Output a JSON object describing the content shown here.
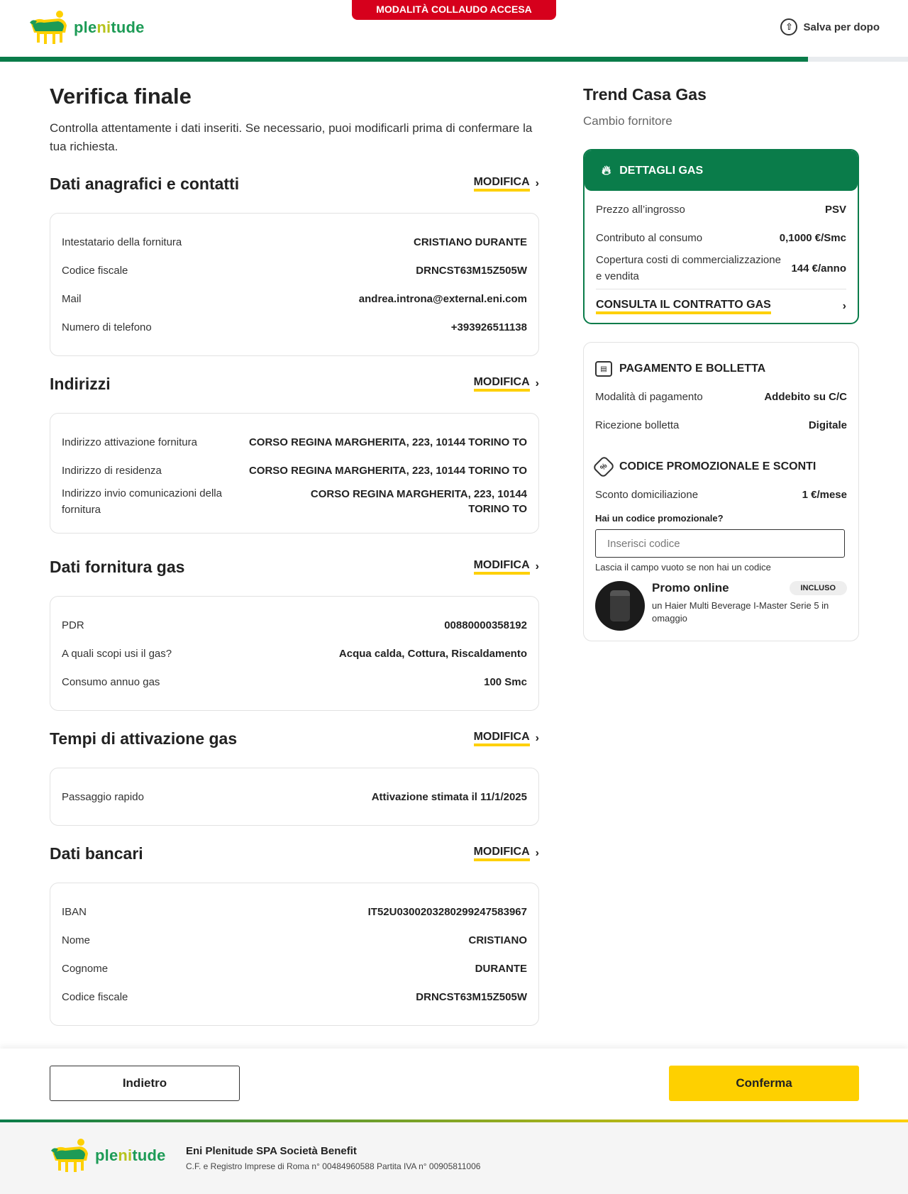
{
  "header": {
    "logo_text_a": "ple",
    "logo_text_b": "ni",
    "logo_text_c": "tude",
    "banner": "MODALITÀ COLLAUDO ACCESA",
    "save_label": "Salva per dopo",
    "progress_percent": 89
  },
  "main": {
    "title": "Verifica finale",
    "description": "Controlla attentamente i dati inseriti. Se necessario, puoi modificarli prima di confermare la tua richiesta.",
    "modifica_label": "MODIFICA",
    "sections": {
      "anagrafica": {
        "title": "Dati anagrafici e contatti",
        "rows": [
          {
            "k": "Intestatario della fornitura",
            "v": "CRISTIANO DURANTE"
          },
          {
            "k": "Codice fiscale",
            "v": "DRNCST63M15Z505W"
          },
          {
            "k": "Mail",
            "v": "andrea.introna@external.eni.com"
          },
          {
            "k": "Numero di telefono",
            "v": "+393926511138"
          }
        ]
      },
      "indirizzi": {
        "title": "Indirizzi",
        "rows": [
          {
            "k": "Indirizzo attivazione fornitura",
            "v": "CORSO REGINA MARGHERITA, 223, 10144 TORINO TO"
          },
          {
            "k": "Indirizzo di residenza",
            "v": "CORSO REGINA MARGHERITA, 223, 10144 TORINO TO"
          },
          {
            "k": "Indirizzo invio comunicazioni della fornitura",
            "v": "CORSO REGINA MARGHERITA, 223, 10144 TORINO TO"
          }
        ]
      },
      "fornitura": {
        "title": "Dati fornitura gas",
        "rows": [
          {
            "k": "PDR",
            "v": "00880000358192"
          },
          {
            "k": "A quali scopi usi il gas?",
            "v": "Acqua calda, Cottura, Riscaldamento"
          },
          {
            "k": "Consumo annuo gas",
            "v": "100 Smc"
          }
        ]
      },
      "tempi": {
        "title": "Tempi di attivazione gas",
        "rows": [
          {
            "k": "Passaggio rapido",
            "v": "Attivazione stimata il 11/1/2025"
          }
        ]
      },
      "bancari": {
        "title": "Dati bancari",
        "rows": [
          {
            "k": "IBAN",
            "v": "IT52U0300203280299247583967"
          },
          {
            "k": "Nome",
            "v": "CRISTIANO"
          },
          {
            "k": "Cognome",
            "v": "DURANTE"
          },
          {
            "k": "Codice fiscale",
            "v": "DRNCST63M15Z505W"
          }
        ]
      }
    }
  },
  "sidebar": {
    "product_title": "Trend Casa Gas",
    "product_subtitle": "Cambio fornitore",
    "gas": {
      "title": "DETTAGLI GAS",
      "rows": [
        {
          "k": "Prezzo all’ingrosso",
          "v": "PSV"
        },
        {
          "k": "Contributo al consumo",
          "v": "0,1000 €/Smc"
        },
        {
          "k": "Copertura costi di commercializzazione e vendita",
          "v": "144 €/anno"
        }
      ],
      "link": "CONSULTA IL CONTRATTO GAS"
    },
    "payment": {
      "title": "PAGAMENTO E BOLLETTA",
      "rows": [
        {
          "k": "Modalità di pagamento",
          "v": "Addebito su C/C"
        },
        {
          "k": "Ricezione bolletta",
          "v": "Digitale"
        }
      ]
    },
    "promo": {
      "title": "CODICE PROMOZIONALE E SCONTI",
      "rows": [
        {
          "k": "Sconto domiciliazione",
          "v": "1 €/mese"
        }
      ],
      "question": "Hai un codice promozionale?",
      "placeholder": "Inserisci codice",
      "hint": "Lascia il campo vuoto se non hai un codice",
      "online_title": "Promo online",
      "online_badge": "INCLUSO",
      "online_desc": "un Haier Multi Beverage I-Master Serie 5 in omaggio"
    }
  },
  "actions": {
    "back": "Indietro",
    "confirm": "Conferma"
  },
  "footer": {
    "company": "Eni Plenitude SPA Società Benefit",
    "legal": "C.F. e Registro Imprese di Roma n° 00484960588 Partita IVA n° 00905811006"
  },
  "icons": {
    "logo": "six-legged-dog-icon",
    "save": "cloud-upload-icon",
    "flame": "flame-icon",
    "payment": "bill-icon",
    "promo": "tag-percent-icon",
    "chevron": "chevron-right-icon"
  },
  "colors": {
    "brand_green": "#0a7c4a",
    "accent_yellow": "#fed000",
    "test_banner_red": "#d6001c"
  }
}
